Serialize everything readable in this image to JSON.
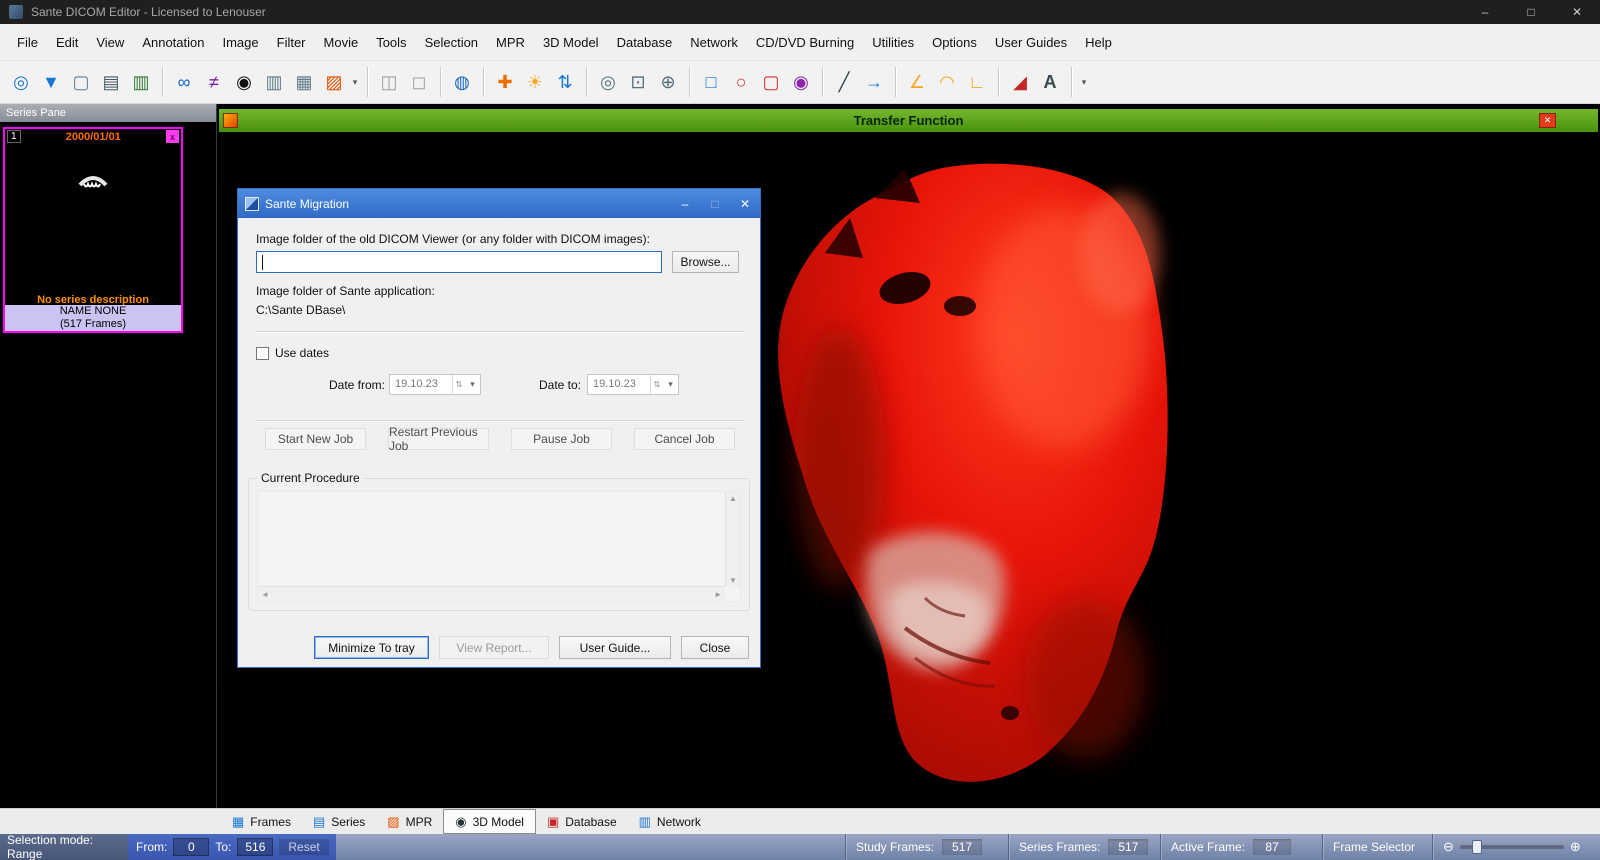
{
  "colors": {
    "dialog_titlebar_blue": "#3b74cf",
    "transfer_bar_green": "#4f9a12",
    "thumbnail_border_magenta": "#ff00ff",
    "skull_render_red": "#e01408",
    "status_range_blue": "#3f62b8"
  },
  "window": {
    "title": "Sante DICOM Editor - Licensed to Lenouser",
    "minimize_glyph": "–",
    "maximize_glyph": "□",
    "close_glyph": "✕"
  },
  "menu": {
    "items": [
      "File",
      "Edit",
      "View",
      "Annotation",
      "Image",
      "Filter",
      "Movie",
      "Tools",
      "Selection",
      "MPR",
      "3D Model",
      "Database",
      "Network",
      "CD/DVD Burning",
      "Utilities",
      "Options",
      "User Guides",
      "Help"
    ]
  },
  "toolbar": {
    "icons": [
      {
        "name": "open-study-icon",
        "glyph": "◎"
      },
      {
        "name": "save-study-icon",
        "glyph": "▼"
      },
      {
        "name": "new-study-icon",
        "glyph": "▢"
      },
      {
        "name": "print-icon",
        "glyph": "▤"
      },
      {
        "name": "export-icon",
        "glyph": "▥"
      },
      {
        "name": "link-series-icon",
        "glyph": "∞"
      },
      {
        "name": "unlink-series-icon",
        "glyph": "≠"
      },
      {
        "name": "shutter-icon",
        "glyph": "◉"
      },
      {
        "name": "window-level-icon",
        "glyph": "▥"
      },
      {
        "name": "image-matrix-icon",
        "glyph": "▦"
      },
      {
        "name": "palette-icon",
        "glyph": "▨"
      },
      {
        "name": "palette-dropdown-icon",
        "glyph": "▾"
      },
      {
        "name": "tile-view-icon",
        "glyph": "◫"
      },
      {
        "name": "full-screen-icon",
        "glyph": "◻"
      },
      {
        "name": "globe-icon",
        "glyph": "◍"
      },
      {
        "name": "pan-icon",
        "glyph": "✚"
      },
      {
        "name": "brightness-icon",
        "glyph": "☀"
      },
      {
        "name": "scroll-frames-icon",
        "glyph": "⇅"
      },
      {
        "name": "zoom-icon",
        "glyph": "◎"
      },
      {
        "name": "zoom-region-icon",
        "glyph": "⊡"
      },
      {
        "name": "zoom-in-icon",
        "glyph": "⊕"
      },
      {
        "name": "rect-select-icon",
        "glyph": "□"
      },
      {
        "name": "ellipse-roi-icon",
        "glyph": "○"
      },
      {
        "name": "rect-roi-icon",
        "glyph": "▢"
      },
      {
        "name": "color-wheel-icon",
        "glyph": "◉"
      },
      {
        "name": "line-tool-icon",
        "glyph": "╱"
      },
      {
        "name": "arrow-tool-icon",
        "glyph": "→"
      },
      {
        "name": "angle-tool-icon",
        "glyph": "∠"
      },
      {
        "name": "curve-tool-icon",
        "glyph": "◠"
      },
      {
        "name": "corner-tool-icon",
        "glyph": "∟"
      },
      {
        "name": "eraser-icon",
        "glyph": "◢"
      },
      {
        "name": "text-tool-icon",
        "glyph": "A"
      },
      {
        "name": "toolbar-overflow-icon",
        "glyph": "▾"
      }
    ]
  },
  "series_pane": {
    "header": "Series Pane",
    "thumb": {
      "index": "1",
      "date": "2000/01/01",
      "close_glyph": "x",
      "description": "No series description",
      "patient_name": "NAME NONE",
      "frames": "(517 Frames)"
    }
  },
  "viewer": {
    "title": "Transfer Function",
    "close_glyph": "✕"
  },
  "dialog": {
    "title": "Sante Migration",
    "minimize_glyph": "–",
    "maximize_glyph": "□",
    "close_glyph": "✕",
    "old_folder_label": "Image folder of the old DICOM Viewer (or any folder with DICOM images):",
    "old_folder_value": "",
    "browse_label": "Browse...",
    "sante_folder_label": "Image folder of Sante application:",
    "sante_folder_value": "C:\\Sante DBase\\",
    "use_dates_label": "Use dates",
    "date_from_label": "Date from:",
    "date_from_value": "19.10.23",
    "date_to_label": "Date to:",
    "date_to_value": "19.10.23",
    "spin_glyph": "⇅",
    "dropdown_glyph": "▾",
    "job_buttons": [
      {
        "label": "Start New Job"
      },
      {
        "label": "Restart Previous Job"
      },
      {
        "label": "Pause Job"
      },
      {
        "label": "Cancel Job"
      }
    ],
    "current_procedure_label": "Current Procedure",
    "scroll_up_glyph": "▲",
    "scroll_down_glyph": "▼",
    "scroll_left_glyph": "◄",
    "scroll_right_glyph": "►",
    "minimize_to_tray_label": "Minimize To tray",
    "view_report_label": "View Report...",
    "user_guide_label": "User Guide...",
    "close_label": "Close"
  },
  "tabs": {
    "items": [
      {
        "label": "Frames",
        "icon": "▦"
      },
      {
        "label": "Series",
        "icon": "▤"
      },
      {
        "label": "MPR",
        "icon": "▨"
      },
      {
        "label": "3D Model",
        "icon": "◉"
      },
      {
        "label": "Database",
        "icon": "▣"
      },
      {
        "label": "Network",
        "icon": "▥"
      }
    ]
  },
  "status_bar": {
    "selection_mode": "Selection mode: Range",
    "from_label": "From:",
    "from_value": "0",
    "to_label": "To:",
    "to_value": "516",
    "reset_label": "Reset",
    "study_frames_label": "Study Frames:",
    "study_frames_value": "517",
    "series_frames_label": "Series Frames:",
    "series_frames_value": "517",
    "active_frame_label": "Active Frame:",
    "active_frame_value": "87",
    "frame_selector_label": "Frame Selector",
    "minus_glyph": "⊖",
    "plus_glyph": "⊕"
  }
}
